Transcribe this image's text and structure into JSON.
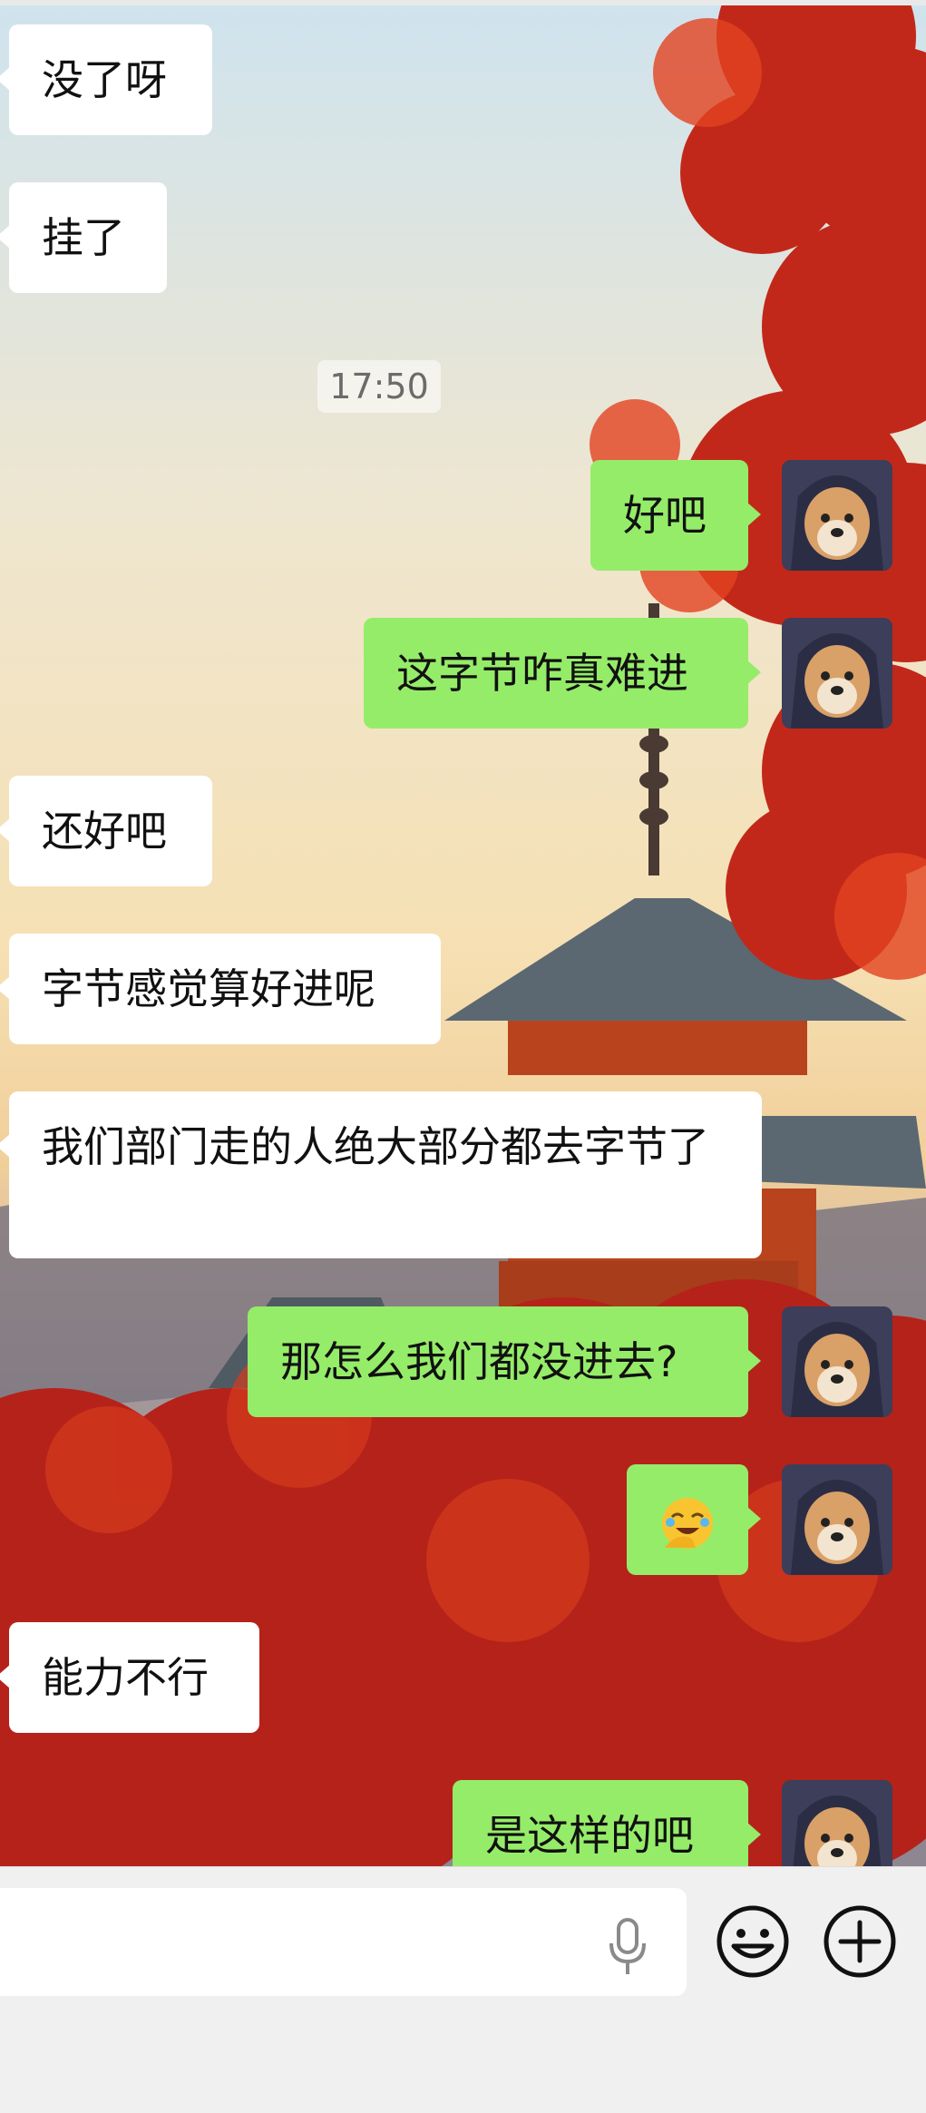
{
  "messages": [
    {
      "side": "in",
      "text": "没了呀"
    },
    {
      "side": "in",
      "text": "挂了"
    },
    {
      "side": "out",
      "text": "好吧"
    },
    {
      "side": "out",
      "text": "这字节咋真难进"
    },
    {
      "side": "in",
      "text": "还好吧"
    },
    {
      "side": "in",
      "text": "字节感觉算好进呢"
    },
    {
      "side": "in",
      "text": "我们部门走的人绝大部分都去字节了"
    },
    {
      "side": "out",
      "text": "那怎么我们都没进去?"
    },
    {
      "side": "out",
      "emoji": "facepalm-laughing-emoji"
    },
    {
      "side": "in",
      "text": "能力不行"
    },
    {
      "side": "out",
      "text": "是这样的吧"
    }
  ],
  "timestamp": "17:50",
  "icons": {
    "mic": "microphone-icon",
    "emoji": "smiley-face-icon",
    "plus": "plus-circle-icon"
  },
  "colors": {
    "out_bubble": "#95ec69",
    "in_bubble": "#ffffff",
    "input_bar": "#f1f0f0"
  }
}
